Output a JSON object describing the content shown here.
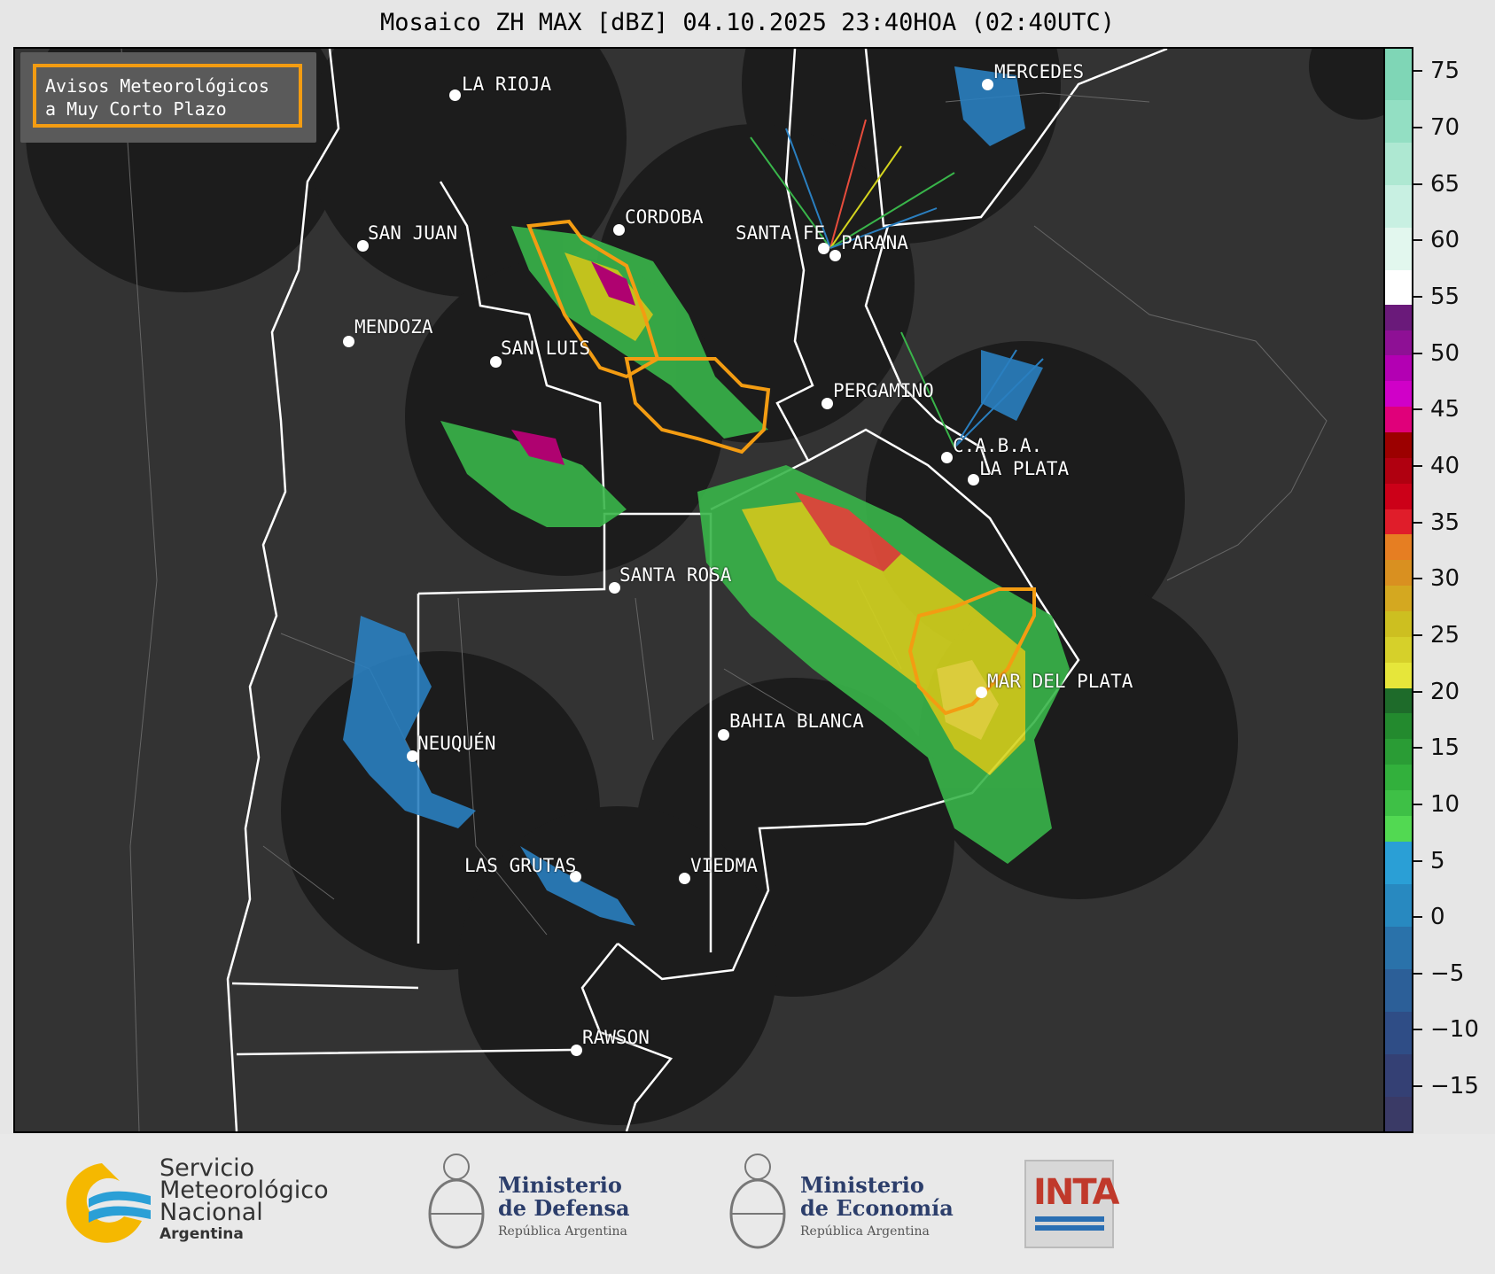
{
  "title": "Mosaico ZH MAX [dBZ] 04.10.2025 23:40HOA (02:40UTC)",
  "legend": {
    "line1": "Avisos Meteorológicos",
    "line2": "a Muy Corto Plazo",
    "warning_color": "#f39c12"
  },
  "cities": [
    {
      "name": "LA RIOJA"
    },
    {
      "name": "MERCEDES"
    },
    {
      "name": "CORDOBA"
    },
    {
      "name": "SAN JUAN"
    },
    {
      "name": "SANTA FE"
    },
    {
      "name": "PARANA"
    },
    {
      "name": "MENDOZA"
    },
    {
      "name": "SAN LUIS"
    },
    {
      "name": "PERGAMINO"
    },
    {
      "name": "C.A.B.A."
    },
    {
      "name": "LA PLATA"
    },
    {
      "name": "SANTA ROSA"
    },
    {
      "name": "MAR DEL PLATA"
    },
    {
      "name": "BAHIA BLANCA"
    },
    {
      "name": "NEUQUÉN"
    },
    {
      "name": "LAS GRUTAS"
    },
    {
      "name": "VIEDMA"
    },
    {
      "name": "RAWSON"
    }
  ],
  "colorbar": {
    "unit": "dBZ",
    "min": -19,
    "max": 77,
    "ticks": [
      "75",
      "70",
      "65",
      "60",
      "55",
      "50",
      "45",
      "40",
      "35",
      "30",
      "25",
      "20",
      "15",
      "10",
      "5",
      "0",
      "−5",
      "−10",
      "−15"
    ]
  },
  "footer": {
    "smn_line1": "Servicio",
    "smn_line2": "Meteorológico",
    "smn_line3": "Nacional",
    "smn_country": "Argentina",
    "defensa_line1": "Ministerio",
    "defensa_line2": "de Defensa",
    "defensa_sub": "República Argentina",
    "economia_line1": "Ministerio",
    "economia_line2": "de Economía",
    "economia_sub": "República Argentina",
    "inta_label": "INTA"
  }
}
